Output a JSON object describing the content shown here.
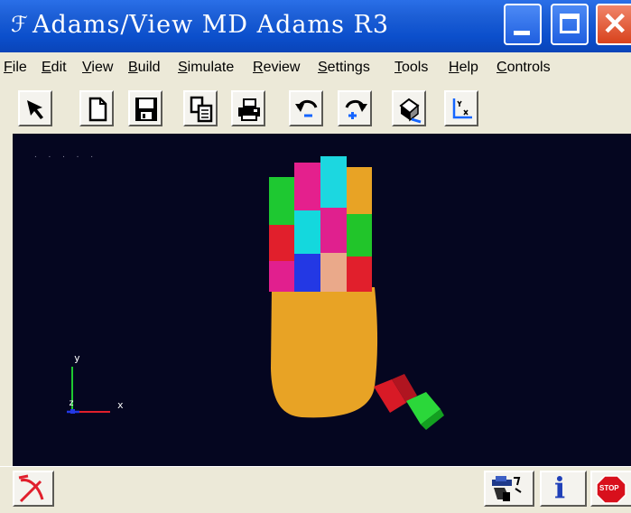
{
  "window": {
    "app_icon": "ℱ",
    "title": "Adams/View MD Adams R3"
  },
  "menu": {
    "items": [
      {
        "label": "File",
        "accel": "F"
      },
      {
        "label": "Edit",
        "accel": "E"
      },
      {
        "label": "View",
        "accel": "V"
      },
      {
        "label": "Build",
        "accel": "B"
      },
      {
        "label": "Simulate",
        "accel": "S"
      },
      {
        "label": "Review",
        "accel": "R"
      },
      {
        "label": "Settings",
        "accel": "S"
      },
      {
        "label": "Tools",
        "accel": "T"
      },
      {
        "label": "Help",
        "accel": "H"
      },
      {
        "label": "Controls",
        "accel": "C"
      }
    ]
  },
  "toolbar": {
    "icons": [
      "select-arrow-icon",
      "new-file-icon",
      "save-icon",
      "copy-icon",
      "print-icon",
      "undo-icon",
      "redo-icon",
      "render-icon",
      "triad-icon"
    ]
  },
  "viewport": {
    "background": "#050620",
    "triad": {
      "x_label": "x",
      "y_label": "y",
      "z_label": "z"
    }
  },
  "statusbar": {
    "info_label": "i",
    "stop_label": "STOP"
  }
}
